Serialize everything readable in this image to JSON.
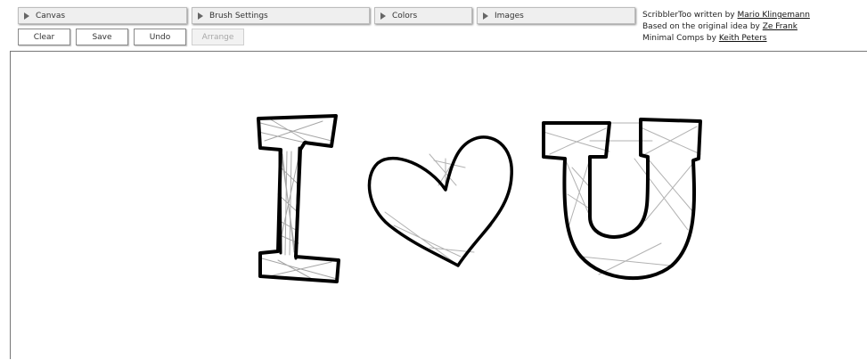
{
  "panels": {
    "canvas": "Canvas",
    "brush": "Brush Settings",
    "colors": "Colors",
    "images": "Images"
  },
  "buttons": {
    "clear": "Clear",
    "save": "Save",
    "undo": "Undo",
    "arrange": "Arrange"
  },
  "credits": {
    "line1_prefix": "ScribblerToo written by ",
    "line1_link": "Mario Klingemann",
    "line2_prefix": "Based on the original idea by ",
    "line2_link": "Ze Frank",
    "line3_prefix": "Minimal Comps by ",
    "line3_link": "Keith Peters"
  },
  "drawing": {
    "subject": "I ♥ U",
    "stroke_color": "#000000"
  }
}
